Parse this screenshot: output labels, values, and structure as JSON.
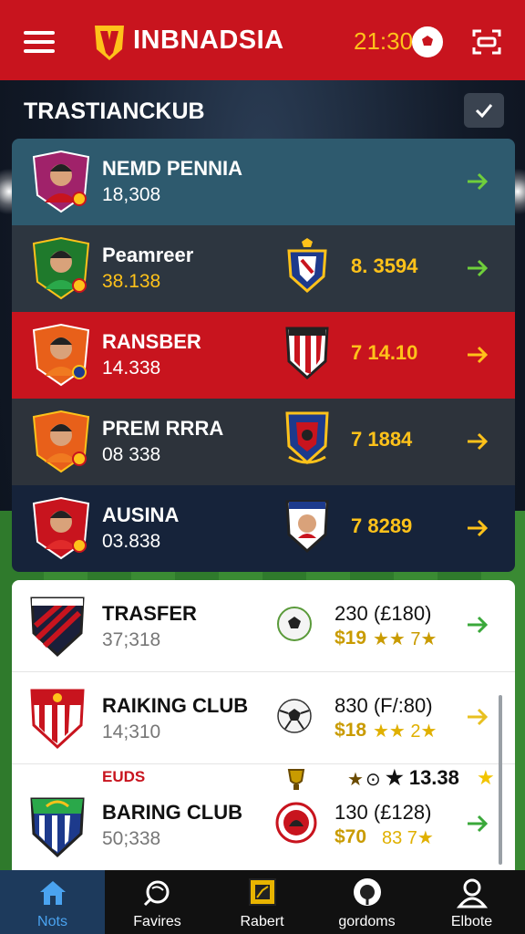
{
  "header": {
    "title": "INBNADSIA",
    "time": "21:30"
  },
  "section": {
    "title": "TRASTIANCKUB"
  },
  "top_list": [
    {
      "name": "NEMD PENNIA",
      "value": "18,308",
      "score": "",
      "bg": "#2e5a6e",
      "arrow_color": "#6fcf3b"
    },
    {
      "name": "Peamreer",
      "value": "38.138",
      "score": "8. 3594",
      "bg": "#2d3640",
      "arrow_color": "#6fcf3b",
      "value_color": "#ffc21a"
    },
    {
      "name": "RANSBER",
      "value": "14.338",
      "score": "7 14.10",
      "bg": "#c8141e",
      "arrow_color": "#ffc21a"
    },
    {
      "name": "PREM RRRA",
      "value": "08 338",
      "score": "7 1884",
      "bg": "#2d333b",
      "arrow_color": "#ffc21a"
    },
    {
      "name": "AUSINA",
      "value": "03.838",
      "score": "7 8289",
      "bg": "#16233a",
      "arrow_color": "#ffc21a"
    }
  ],
  "white_list": [
    {
      "name": "TRASFER",
      "value": "37;318",
      "price": "230 (£180)",
      "rating": "$19",
      "stars": "★★ 7★",
      "arrow_color": "#3aa83a"
    },
    {
      "name": "RAIKING CLUB",
      "value": "14;310",
      "price": "830 (F/:80)",
      "rating": "$18",
      "stars": "★★ 2★",
      "arrow_color": "#e8c020"
    },
    {
      "name": "BARING CLUB",
      "value": "50;338",
      "price": "130 (£128)",
      "rating": "$70",
      "stars": "83 7★",
      "arrow_color": "#3aa83a",
      "tag": "EUDS",
      "extra": "★ 13.38"
    }
  ],
  "nav": [
    {
      "label": "Nots",
      "icon": "home-icon",
      "active": true
    },
    {
      "label": "Favires",
      "icon": "search-icon",
      "active": false
    },
    {
      "label": "Rabert",
      "icon": "chart-icon",
      "active": false
    },
    {
      "label": "gordoms",
      "icon": "ball-icon",
      "active": false
    },
    {
      "label": "Elbote",
      "icon": "profile-icon",
      "active": false
    }
  ],
  "colors": {
    "brand": "#c8141e",
    "accent": "#ffc21a",
    "active_nav": "#4aa3f0"
  }
}
